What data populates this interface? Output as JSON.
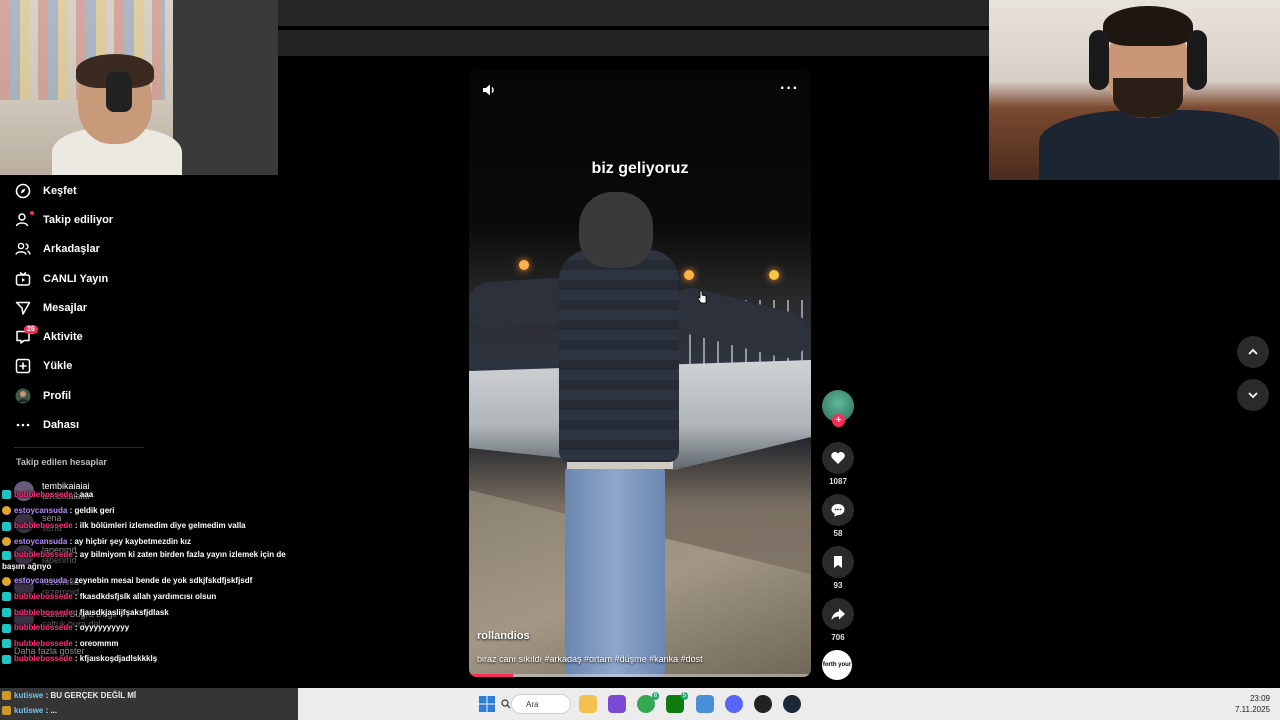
{
  "sidebar": {
    "items": [
      {
        "label": "Keşfet",
        "icon": "compass-icon"
      },
      {
        "label": "Takip ediliyor",
        "icon": "following-icon"
      },
      {
        "label": "Arkadaşlar",
        "icon": "friends-icon"
      },
      {
        "label": "CANLI Yayın",
        "icon": "live-icon"
      },
      {
        "label": "Mesajlar",
        "icon": "send-icon"
      },
      {
        "label": "Aktivite",
        "icon": "activity-icon",
        "badge": "26"
      },
      {
        "label": "Yükle",
        "icon": "upload-icon"
      },
      {
        "label": "Profil",
        "icon": "avatar-icon"
      },
      {
        "label": "Dahası",
        "icon": "more-icon"
      }
    ],
    "following_title": "Takip edilen hesaplar",
    "accounts": [
      {
        "name": "tembikaiaiai",
        "handle": "tembikaiaiai"
      },
      {
        "name": "sena",
        "handle": "sena"
      },
      {
        "name": "lapenmd",
        "handle": "lapenmd"
      },
      {
        "name": "rezemnid",
        "handle": "rezemnid"
      },
      {
        "name": "Saltuk Buğra Dağlı",
        "handle": "saltuk.bura.dal"
      },
      {
        "name": "Daha fazla göster",
        "handle": ""
      }
    ]
  },
  "chat": {
    "messages": [
      {
        "user": "bubblebossede",
        "text": "aaa",
        "badge": "teal"
      },
      {
        "user": "estoycansuda",
        "text": "geldik geri",
        "badge": "gold"
      },
      {
        "user": "bubblebossede",
        "text": "ilk bölümleri izlemedim diye gelmedim valla",
        "badge": "teal"
      },
      {
        "user": "estoycansuda",
        "text": "ay hiçbir şey kaybetmezdin kız",
        "badge": "gold"
      },
      {
        "user": "bubblebossede",
        "text": "ay bilmiyom ki zaten birden fazla yayın izlemek için de başım ağrıyo",
        "badge": "teal",
        "wrap": true
      },
      {
        "user": "estoycansuda",
        "text": "zeynebin mesai bende de yok sdkjfskdfjskfjsdf",
        "badge": "gold"
      },
      {
        "user": "bubblebossede",
        "text": "fkasdkdsfjslk allah yardımcısı olsun",
        "badge": "teal"
      },
      {
        "user": "bubblebossede",
        "text": "fjaısdkjaslijfşaksfjdlask",
        "badge": "teal"
      },
      {
        "user": "bubblebossede",
        "text": "oyyyyyyyyyy",
        "badge": "teal"
      },
      {
        "user": "bubblebossede",
        "text": "oreommm",
        "badge": "teal"
      },
      {
        "user": "bubblebossede",
        "text": "kfjaıskoşdjadlskkklş",
        "badge": "teal"
      }
    ],
    "input_rows": [
      {
        "user": "kutiswe",
        "text": "BU GERÇEK DEĞİL Mİ"
      },
      {
        "user": "kutiswe",
        "text": "..."
      }
    ]
  },
  "video": {
    "caption_overlay": "biz geliyoruz",
    "author": "rollandios",
    "description": "biraz canı sıkıldı #arkadaş #ortam #düşme  #kanka #dost",
    "progress": 0.13,
    "more_label": "···"
  },
  "actions": {
    "follow_plus": "+",
    "likes": "1087",
    "comments": "58",
    "saves": "93",
    "shares": "706",
    "sound_label": "forth your"
  },
  "taskbar": {
    "search_label": "Ara",
    "time": "23:09",
    "date": "7.11.2025",
    "apps": [
      {
        "name": "file-explorer-icon",
        "color": "#f2c14e"
      },
      {
        "name": "app-purple-icon",
        "color": "#7b4bd6"
      },
      {
        "name": "chrome-icon",
        "color": "#34a853",
        "badge": "8"
      },
      {
        "name": "xbox-icon",
        "color": "#107c10",
        "badge": "5"
      },
      {
        "name": "settings-icon",
        "color": "#4a90d9"
      },
      {
        "name": "discord-icon",
        "color": "#5865f2"
      },
      {
        "name": "obs-icon",
        "color": "#222222"
      },
      {
        "name": "steam-icon",
        "color": "#1b2838"
      }
    ]
  },
  "colors": {
    "accent": "#fe2c55",
    "chat_user_pink": "#ff2d7a",
    "chat_user_purple": "#b78cff"
  }
}
